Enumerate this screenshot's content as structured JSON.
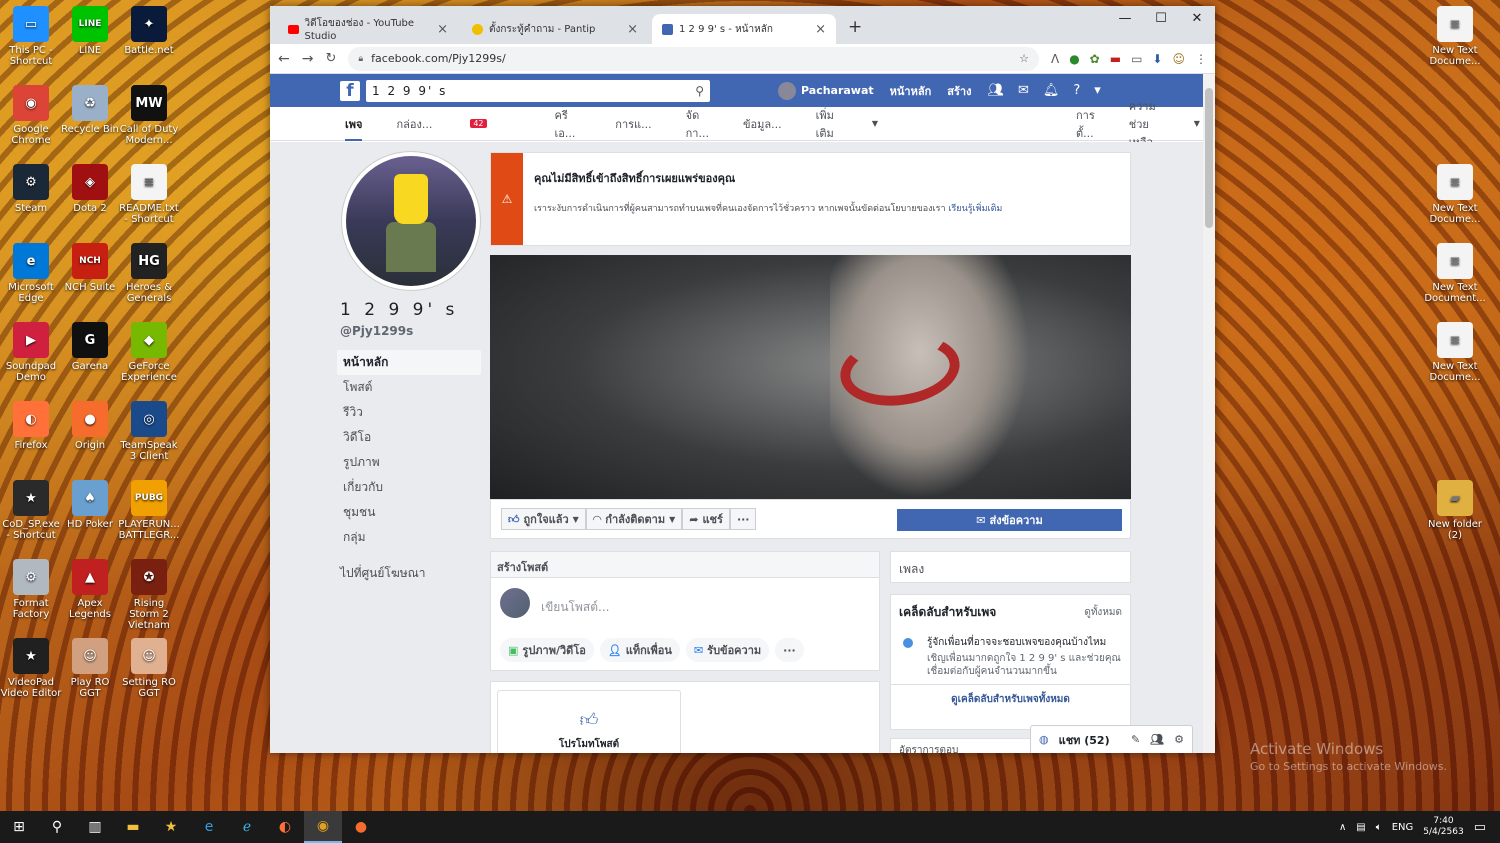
{
  "desktop": {
    "left_icons": [
      {
        "label": "This PC - Shortcut",
        "icon": "pc-icon",
        "color": "#1e90ff",
        "glyph": "▭"
      },
      {
        "label": "LINE",
        "icon": "line-icon",
        "color": "#00c300",
        "glyph": "LINE"
      },
      {
        "label": "Battle.net",
        "icon": "battlenet-icon",
        "color": "#0a1a3a",
        "glyph": "✦"
      },
      {
        "label": "Google Chrome",
        "icon": "chrome-icon",
        "color": "#db4437",
        "glyph": "◉"
      },
      {
        "label": "Recycle Bin",
        "icon": "recycle-bin-icon",
        "color": "#9ab0c8",
        "glyph": "♻"
      },
      {
        "label": "Call of Duty Modern...",
        "icon": "cod-icon",
        "color": "#111",
        "glyph": "MW"
      },
      {
        "label": "Steam",
        "icon": "steam-icon",
        "color": "#1b2838",
        "glyph": "⚙"
      },
      {
        "label": "Dota 2",
        "icon": "dota-icon",
        "color": "#a01010",
        "glyph": "◈"
      },
      {
        "label": "README.txt - Shortcut",
        "icon": "text-file-icon",
        "color": "#f4f4f4",
        "glyph": "≡"
      },
      {
        "label": "Microsoft Edge",
        "icon": "edge-icon",
        "color": "#0078d7",
        "glyph": "e"
      },
      {
        "label": "NCH Suite",
        "icon": "nch-icon",
        "color": "#c82010",
        "glyph": "NCH"
      },
      {
        "label": "Heroes & Generals",
        "icon": "hg-icon",
        "color": "#222",
        "glyph": "HG"
      },
      {
        "label": "Soundpad Demo",
        "icon": "soundpad-icon",
        "color": "#d02040",
        "glyph": "▶"
      },
      {
        "label": "Garena",
        "icon": "garena-icon",
        "color": "#101010",
        "glyph": "G"
      },
      {
        "label": "GeForce Experience",
        "icon": "geforce-icon",
        "color": "#76b900",
        "glyph": "◆"
      },
      {
        "label": "Firefox",
        "icon": "firefox-icon",
        "color": "#ff7139",
        "glyph": "◐"
      },
      {
        "label": "Origin",
        "icon": "origin-icon",
        "color": "#f56c2d",
        "glyph": "●"
      },
      {
        "label": "TeamSpeak 3 Client",
        "icon": "teamspeak-icon",
        "color": "#1a4a8a",
        "glyph": "◎"
      },
      {
        "label": "CoD_SP.exe - Shortcut",
        "icon": "cod-sp-icon",
        "color": "#2a2a2a",
        "glyph": "★"
      },
      {
        "label": "HD Poker",
        "icon": "poker-icon",
        "color": "#6aa0d0",
        "glyph": "♠"
      },
      {
        "label": "PLAYERUN... BATTLEGR...",
        "icon": "pubg-icon",
        "color": "#f0a000",
        "glyph": "PUBG"
      },
      {
        "label": "Format Factory",
        "icon": "format-factory-icon",
        "color": "#b0b8c0",
        "glyph": "⚙"
      },
      {
        "label": "Apex Legends",
        "icon": "apex-icon",
        "color": "#c02020",
        "glyph": "▲"
      },
      {
        "label": "Rising Storm 2 Vietnam",
        "icon": "rising-storm-icon",
        "color": "#7a2010",
        "glyph": "✪"
      },
      {
        "label": "VideoPad Video Editor",
        "icon": "videopad-icon",
        "color": "#202020",
        "glyph": "★"
      },
      {
        "label": "Play RO GGT",
        "icon": "ro-play-icon",
        "color": "#d0a080",
        "glyph": "☺"
      },
      {
        "label": "Setting RO GGT",
        "icon": "ro-setting-icon",
        "color": "#e0b090",
        "glyph": "☺"
      }
    ],
    "right_icons": [
      {
        "label": "New Text Docume...",
        "icon": "text-file-icon",
        "glyph": "≡"
      },
      {
        "label": "New Text Docume...",
        "icon": "text-file-icon",
        "glyph": "≡"
      },
      {
        "label": "New Text Document...",
        "icon": "text-file-icon",
        "glyph": "≡"
      },
      {
        "label": "New Text Docume...",
        "icon": "text-file-icon",
        "glyph": "≡"
      },
      {
        "label": "New folder (2)",
        "icon": "folder-icon",
        "glyph": "▰"
      }
    ],
    "watermark": {
      "title": "Activate Windows",
      "subtitle": "Go to Settings to activate Windows."
    }
  },
  "browser": {
    "tabs": [
      {
        "title": "วิดีโอของช่อง - YouTube Studio",
        "icon": "youtube-icon",
        "color": "#ff0000"
      },
      {
        "title": "ตั้งกระทู้คำถาม - Pantip",
        "icon": "pantip-icon",
        "color": "#f0c000"
      },
      {
        "title": "1 2 9 9' s - หน้าหลัก",
        "icon": "facebook-tab-icon",
        "color": "#4267b2"
      }
    ],
    "url": "facebook.com/Pjy1299s/"
  },
  "facebook": {
    "brand_color": "#4267b2",
    "search_value": "1 2 9 9' s",
    "user_name": "Pacharawat",
    "nav": {
      "home": "หน้าหลัก",
      "create": "สร้าง"
    },
    "subnav": {
      "page": "เพจ",
      "inbox": "กล่อง...",
      "inbox_badge": "42",
      "creator": "ครีเอ...",
      "manage": "การแ...",
      "publishing": "จัดกา...",
      "insights": "ข้อมูล...",
      "more": "เพิ่มเติม",
      "settings": "การตั้...",
      "help": "ความช่วยเหลือ"
    },
    "page": {
      "name": "1 2 9 9' s",
      "handle": "@Pjy1299s",
      "menu": [
        "หน้าหลัก",
        "โพสต์",
        "รีวิว",
        "วิดีโอ",
        "รูปภาพ",
        "เกี่ยวกับ",
        "ชุมชน",
        "กลุ่ม"
      ],
      "ad_center": "ไปที่ศูนย์โฆษณา"
    },
    "alert": {
      "title": "คุณไม่มีสิทธิ์เข้าถึงสิทธิ์การเผยแพร่ของคุณ",
      "message": "เราระงับการดำเนินการที่ผู้คนสามารถทำบนเพจที่คนเองจัดการไว้ชั่วคราว หากเพจนั้นขัดต่อนโยบายของเรา",
      "link": "เรียนรู้เพิ่มเติม"
    },
    "cta": {
      "liked": "ถูกใจแล้ว",
      "following": "กำลังติดตาม",
      "share": "แชร์",
      "more": "···",
      "message": "ส่งข้อความ"
    },
    "composer": {
      "title": "สร้างโพสต์",
      "placeholder": "เขียนโพสต์...",
      "photo": "รูปภาพ/วิดีโอ",
      "tag": "แท็กเพื่อน",
      "messages": "รับข้อความ",
      "more": "···"
    },
    "promo": {
      "label": "โปรโมทโพสต์"
    },
    "music": {
      "title": "เพลง"
    },
    "tips": {
      "title": "เคล็ดลับสำหรับเพจ",
      "see_all": "ดูทั้งหมด",
      "tip_title": "รู้จักเพื่อนที่อาจจะชอบเพจของคุณบ้างไหม",
      "tip_body": "เชิญเพื่อนมากดถูกใจ 1 2 9 9' s และช่วยคุณเชื่อมต่อกับผู้คนจำนวนมากขึ้น",
      "link": "ดูเคล็ดลับสำหรับเพจทั้งหมด"
    },
    "response_rate": "อัตราการตอบ",
    "chat": {
      "label": "แชท (52)"
    }
  },
  "taskbar": {
    "tray_lang": "ENG",
    "time": "7:40",
    "date": "5/4/2563"
  }
}
